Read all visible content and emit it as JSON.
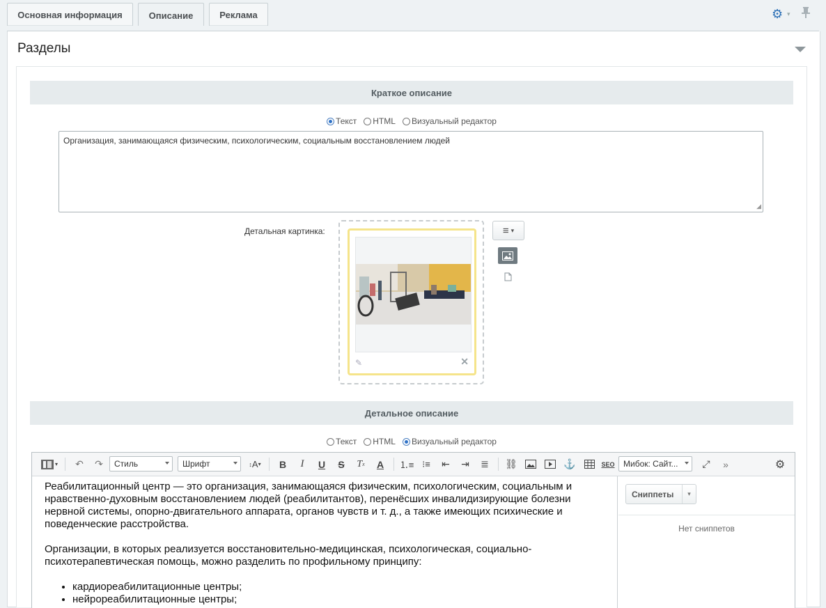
{
  "tabs": [
    {
      "label": "Основная информация"
    },
    {
      "label": "Описание"
    },
    {
      "label": "Реклама"
    }
  ],
  "section": {
    "title": "Разделы"
  },
  "short_description": {
    "heading": "Краткое описание",
    "modes": [
      "Текст",
      "HTML",
      "Визуальный редактор"
    ],
    "selected_mode": "Текст",
    "text": "Организация, занимающаяся физическим, психологическим, социальным восстановлением людей"
  },
  "detail_picture": {
    "label": "Детальная картинка:"
  },
  "detail_description": {
    "heading": "Детальное описание",
    "modes": [
      "Текст",
      "HTML",
      "Визуальный редактор"
    ],
    "selected_mode": "Визуальный редактор",
    "toolbar": {
      "style_select": "Стиль",
      "font_select": "Шрифт",
      "template_select": "Мибок: Сайт..."
    },
    "content": {
      "p1": "Реабилитационный центр — это организация, занимающаяся физическим, психологическим, социальным и нравственно-духовным восстановлением людей (реабилитантов), перенёсших инвалидизирующие болезни нервной системы, опорно-двигательного аппарата, органов чувств и т. д., а также имеющих психические и поведенческие расстройства.",
      "p2": "Организации, в которых реализуется восстановительно-медицинская, психологическая, социально-психотерапевтическая помощь, можно разделить по профильному принципу:",
      "list": [
        "кардиореабилитационные центры;",
        "нейрореабилитационные центры;"
      ]
    },
    "snippets": {
      "button": "Сниппеты",
      "empty": "Нет сниппетов"
    }
  },
  "colors": {
    "accent": "#2f72b7",
    "header_bg": "#e6ebed",
    "frame_highlight": "#f5e48a"
  }
}
